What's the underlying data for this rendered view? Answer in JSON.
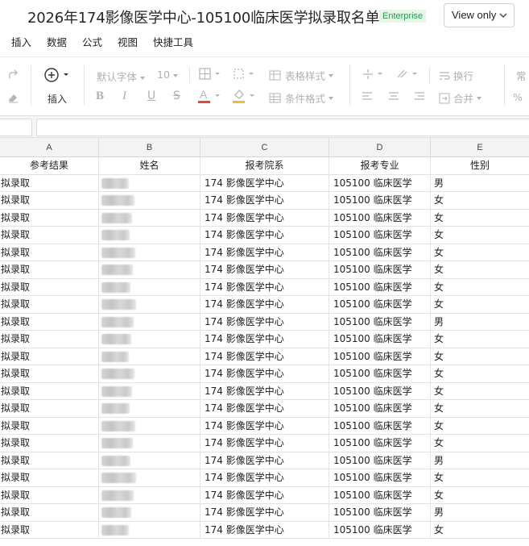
{
  "doc": {
    "title": "2026年174影像医学中心-105100临床医学拟录取名单",
    "badge": "Enterprise",
    "view_mode": "View only"
  },
  "menu": [
    "插入",
    "数据",
    "公式",
    "视图",
    "快捷工具"
  ],
  "toolbar": {
    "insert_label": "插入",
    "font_name": "默认字体",
    "font_size": "10",
    "table_style": "表格样式",
    "conditional_format": "条件格式",
    "wrap": "换行",
    "merge": "合并",
    "normal": "常",
    "percent": "%"
  },
  "columns": [
    "A",
    "B",
    "C",
    "D",
    "E"
  ],
  "headers": [
    "参考结果",
    "姓名",
    "报考院系",
    "报考专业",
    "性别"
  ],
  "rows": [
    {
      "result": "拟录取",
      "name": "",
      "dept": "174 影像医学中心",
      "major": "105100 临床医学",
      "gender": "男"
    },
    {
      "result": "拟录取",
      "name": "",
      "dept": "174 影像医学中心",
      "major": "105100 临床医学",
      "gender": "女"
    },
    {
      "result": "拟录取",
      "name": "",
      "dept": "174 影像医学中心",
      "major": "105100 临床医学",
      "gender": "女"
    },
    {
      "result": "拟录取",
      "name": "",
      "dept": "174 影像医学中心",
      "major": "105100 临床医学",
      "gender": "女"
    },
    {
      "result": "拟录取",
      "name": "",
      "dept": "174 影像医学中心",
      "major": "105100 临床医学",
      "gender": "女"
    },
    {
      "result": "拟录取",
      "name": "",
      "dept": "174 影像医学中心",
      "major": "105100 临床医学",
      "gender": "女"
    },
    {
      "result": "拟录取",
      "name": "",
      "dept": "174 影像医学中心",
      "major": "105100 临床医学",
      "gender": "女"
    },
    {
      "result": "拟录取",
      "name": "",
      "dept": "174 影像医学中心",
      "major": "105100 临床医学",
      "gender": "女"
    },
    {
      "result": "拟录取",
      "name": "",
      "dept": "174 影像医学中心",
      "major": "105100 临床医学",
      "gender": "男"
    },
    {
      "result": "拟录取",
      "name": "",
      "dept": "174 影像医学中心",
      "major": "105100 临床医学",
      "gender": "女"
    },
    {
      "result": "拟录取",
      "name": "",
      "dept": "174 影像医学中心",
      "major": "105100 临床医学",
      "gender": "女"
    },
    {
      "result": "拟录取",
      "name": "",
      "dept": "174 影像医学中心",
      "major": "105100 临床医学",
      "gender": "女"
    },
    {
      "result": "拟录取",
      "name": "",
      "dept": "174 影像医学中心",
      "major": "105100 临床医学",
      "gender": "女"
    },
    {
      "result": "拟录取",
      "name": "",
      "dept": "174 影像医学中心",
      "major": "105100 临床医学",
      "gender": "女"
    },
    {
      "result": "拟录取",
      "name": "",
      "dept": "174 影像医学中心",
      "major": "105100 临床医学",
      "gender": "女"
    },
    {
      "result": "拟录取",
      "name": "",
      "dept": "174 影像医学中心",
      "major": "105100 临床医学",
      "gender": "女"
    },
    {
      "result": "拟录取",
      "name": "",
      "dept": "174 影像医学中心",
      "major": "105100 临床医学",
      "gender": "男"
    },
    {
      "result": "拟录取",
      "name": "",
      "dept": "174 影像医学中心",
      "major": "105100 临床医学",
      "gender": "女"
    },
    {
      "result": "拟录取",
      "name": "",
      "dept": "174 影像医学中心",
      "major": "105100 临床医学",
      "gender": "女"
    },
    {
      "result": "拟录取",
      "name": "",
      "dept": "174 影像医学中心",
      "major": "105100 临床医学",
      "gender": "男"
    },
    {
      "result": "拟录取",
      "name": "",
      "dept": "174 影像医学中心",
      "major": "105100 临床医学",
      "gender": "女"
    }
  ],
  "colors": {
    "badge_bg": "#e6f7ea",
    "badge_text": "#1f9d4a",
    "header_bg": "#f3f3f3",
    "gridline": "#e3e3e3"
  },
  "icons": [
    "redo-icon",
    "eraser-icon",
    "insert-plus-icon",
    "bold-icon",
    "italic-icon",
    "underline-icon",
    "strikethrough-icon",
    "font-color-icon",
    "fill-color-icon",
    "border-icon",
    "crop-icon",
    "table-style-icon",
    "conditional-format-icon",
    "align-icon",
    "wrap-icon",
    "merge-icon",
    "chevron-down-icon"
  ]
}
